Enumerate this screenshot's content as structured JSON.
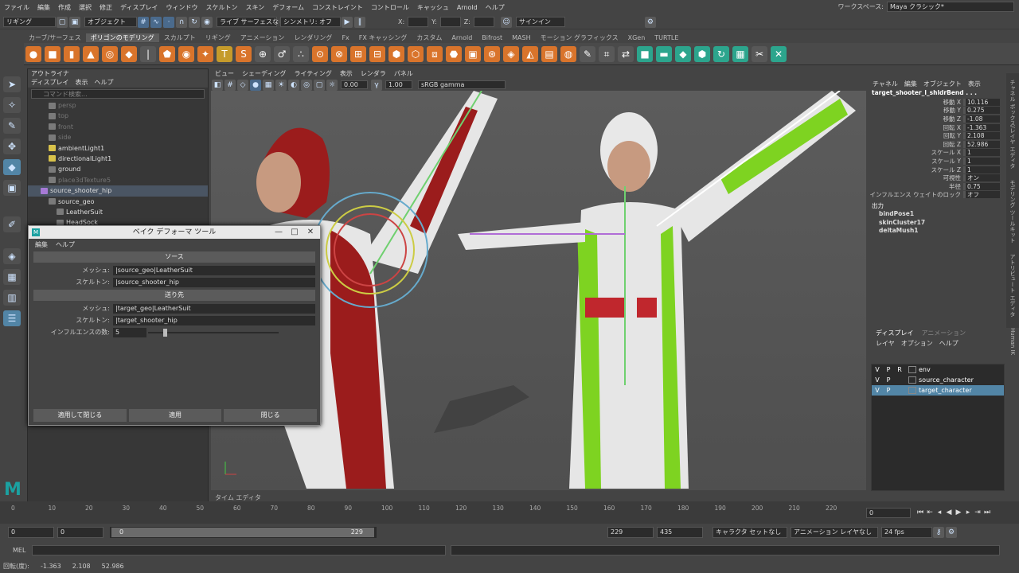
{
  "menu": [
    "ファイル",
    "編集",
    "作成",
    "選択",
    "修正",
    "ディスプレイ",
    "ウィンドウ",
    "スケルトン",
    "スキン",
    "デフォーム",
    "コンストレイント",
    "コントロール",
    "キャッシュ",
    "Arnold",
    "ヘルプ"
  ],
  "workspace": {
    "label": "ワークスペース:",
    "value": "Maya クラシック*"
  },
  "status": {
    "mode": "リギング",
    "obj": "オブジェクト",
    "live": "ライブ サーフェスなし",
    "sym": "シンメトリ: オフ",
    "x": "X:",
    "y": "Y:",
    "z": "Z:",
    "signin": "サインイン"
  },
  "shelf_tabs": [
    "カーブ/サーフェス",
    "ポリゴンのモデリング",
    "スカルプト",
    "リギング",
    "アニメーション",
    "レンダリング",
    "Fx",
    "FX キャッシング",
    "カスタム",
    "Arnold",
    "Bifrost",
    "MASH",
    "モーション グラフィックス",
    "XGen",
    "TURTLE"
  ],
  "outliner": {
    "title": "アウトライナ",
    "menu": [
      "ディスプレイ",
      "表示",
      "ヘルプ"
    ],
    "search": "コマンド検索...",
    "items": [
      {
        "label": "persp",
        "dim": true
      },
      {
        "label": "top",
        "dim": true
      },
      {
        "label": "front",
        "dim": true
      },
      {
        "label": "side",
        "dim": true
      },
      {
        "label": "ambientLight1",
        "dim": false
      },
      {
        "label": "directionalLight1",
        "dim": false
      },
      {
        "label": "ground",
        "dim": false
      },
      {
        "label": "place3dTexture5",
        "dim": true
      },
      {
        "label": "source_shooter_hip",
        "dim": false,
        "sel": true
      },
      {
        "label": "source_geo",
        "dim": false
      },
      {
        "label": "LeatherSuit",
        "dim": false
      },
      {
        "label": "HeadSock",
        "dim": false
      }
    ]
  },
  "viewport": {
    "menu": [
      "ビュー",
      "シェーディング",
      "ライティング",
      "表示",
      "レンダラ",
      "パネル"
    ],
    "val1": "0.00",
    "val2": "1.00",
    "colorspace": "sRGB gamma"
  },
  "channel": {
    "menu": [
      "チャネル",
      "編集",
      "オブジェクト",
      "表示"
    ],
    "node": "target_shooter_l_shldrBend . . .",
    "attrs": [
      {
        "l": "移動 X",
        "v": "10.116"
      },
      {
        "l": "移動 Y",
        "v": "0.275"
      },
      {
        "l": "移動 Z",
        "v": "-1.08"
      },
      {
        "l": "回転 X",
        "v": "-1.363"
      },
      {
        "l": "回転 Y",
        "v": "2.108"
      },
      {
        "l": "回転 Z",
        "v": "52.986"
      },
      {
        "l": "スケール X",
        "v": "1"
      },
      {
        "l": "スケール Y",
        "v": "1"
      },
      {
        "l": "スケール Z",
        "v": "1"
      },
      {
        "l": "可視性",
        "v": "オン"
      },
      {
        "l": "半径",
        "v": "0.75"
      },
      {
        "l": "インフルエンス ウェイトのロック",
        "v": "オフ"
      }
    ],
    "outputs_label": "出力",
    "outputs": [
      "bindPose1",
      "skinCluster17",
      "deltaMush1"
    ]
  },
  "vtabs": [
    "チャネル ボックス/レイヤ エディタ",
    "モデリング ツールキット",
    "アトリビュート エディタ",
    "Human IK"
  ],
  "layers": {
    "tabs": [
      "ディスプレイ",
      "アニメーション"
    ],
    "menu": [
      "レイヤ",
      "オプション",
      "ヘルプ"
    ],
    "rows": [
      {
        "v": "V",
        "p": "P",
        "r": "R",
        "name": "env",
        "sel": false
      },
      {
        "v": "V",
        "p": "P",
        "r": "",
        "name": "source_character",
        "sel": false
      },
      {
        "v": "V",
        "p": "P",
        "r": "",
        "name": "target_character",
        "sel": true
      }
    ]
  },
  "dialog": {
    "title": "ベイク デフォーマ ツール",
    "menu": [
      "編集",
      "ヘルプ"
    ],
    "source_label": "ソース",
    "dest_label": "送り先",
    "mesh_label": "メッシュ:",
    "skel_label": "スケルトン:",
    "src_mesh": "|source_geo|LeatherSuit",
    "src_skel": "|source_shooter_hip",
    "dst_mesh": "|target_geo|LeatherSuit",
    "dst_skel": "|target_shooter_hip",
    "inf_label": "インフルエンスの数:",
    "inf_value": "5",
    "btn_apply_close": "適用して閉じる",
    "btn_apply": "適用",
    "btn_close": "閉じる"
  },
  "timeline": {
    "ticks": [
      "0",
      "10",
      "20",
      "30",
      "40",
      "50",
      "60",
      "70",
      "80",
      "90",
      "100",
      "110",
      "120",
      "130",
      "140",
      "150",
      "160",
      "170",
      "180",
      "190",
      "200",
      "210",
      "220"
    ],
    "label": "タイム エディタ",
    "current": "0"
  },
  "range": {
    "start": "0",
    "pstart": "0",
    "slider_start": "0",
    "slider_end": "229",
    "pend": "229",
    "end": "435",
    "char": "キャラクタ セットなし",
    "anim": "アニメーション レイヤなし",
    "fps": "24 fps"
  },
  "mel": {
    "label": "MEL"
  },
  "help": {
    "label": "回転(度):",
    "x": "-1.363",
    "y": "2.108",
    "z": "52.986"
  },
  "colors": {
    "accent": "#5285a6",
    "red_suit": "#9b1c1c",
    "green_suit": "#7ed321"
  }
}
